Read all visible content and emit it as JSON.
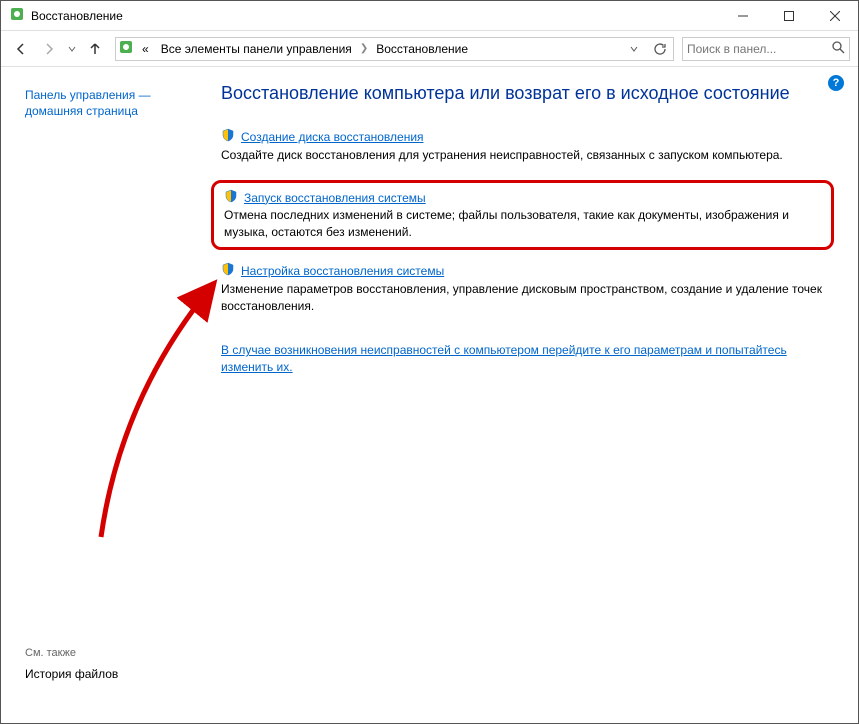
{
  "window": {
    "title": "Восстановление"
  },
  "toolbar": {
    "breadcrumb_prefix": "«",
    "crumb1": "Все элементы панели управления",
    "crumb2": "Восстановление",
    "search_placeholder": "Поиск в панел..."
  },
  "sidebar": {
    "home_line1": "Панель управления —",
    "home_line2": "домашняя страница",
    "see_also": "См. также",
    "history": "История файлов"
  },
  "main": {
    "heading": "Восстановление компьютера или возврат его в исходное состояние",
    "opt1_title": "Создание диска восстановления",
    "opt1_desc": "Создайте диск восстановления для устранения неисправностей, связанных с запуском компьютера.",
    "opt2_title": "Запуск восстановления системы",
    "opt2_desc": "Отмена последних изменений в системе; файлы пользователя, такие как документы, изображения и музыка, остаются без изменений.",
    "opt3_title": "Настройка восстановления системы",
    "opt3_desc": "Изменение параметров восстановления, управление дисковым пространством, создание и удаление точек восстановления.",
    "bottom_link": "В случае возникновения неисправностей с компьютером перейдите к его параметрам и попытайтесь изменить их."
  }
}
